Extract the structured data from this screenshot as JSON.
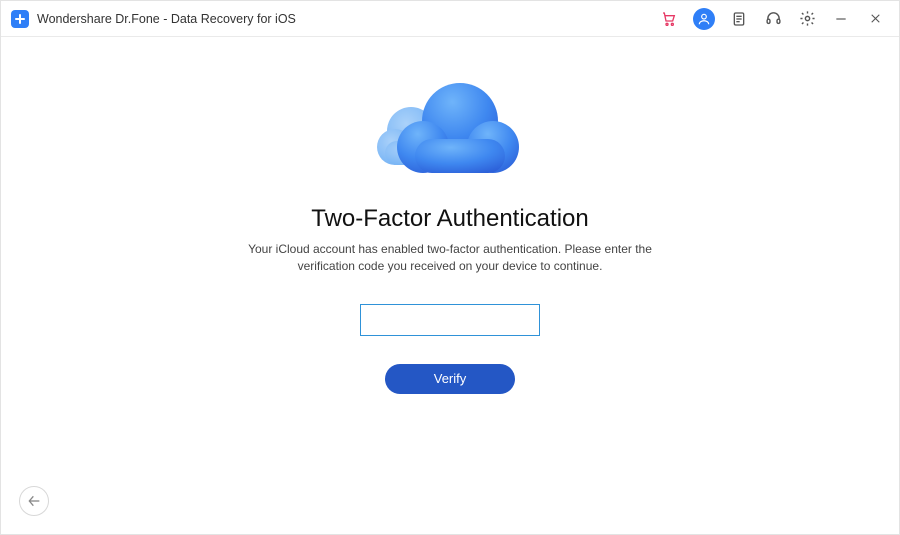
{
  "titlebar": {
    "app_title": "Wondershare Dr.Fone - Data Recovery for iOS"
  },
  "toolbar": {
    "cart_icon": "cart-icon",
    "account_icon": "account-icon",
    "notes_icon": "notes-icon",
    "support_icon": "support-icon",
    "settings_icon": "settings-icon",
    "minimize_icon": "minimize-icon",
    "close_icon": "close-icon"
  },
  "main": {
    "heading": "Two-Factor Authentication",
    "description": "Your iCloud account has enabled two-factor authentication. Please enter the verification code you received on your device to continue.",
    "code_value": "",
    "code_placeholder": "",
    "verify_label": "Verify"
  },
  "colors": {
    "accent": "#2f7ff7",
    "button": "#2457c5",
    "input_border": "#2f92d8"
  }
}
